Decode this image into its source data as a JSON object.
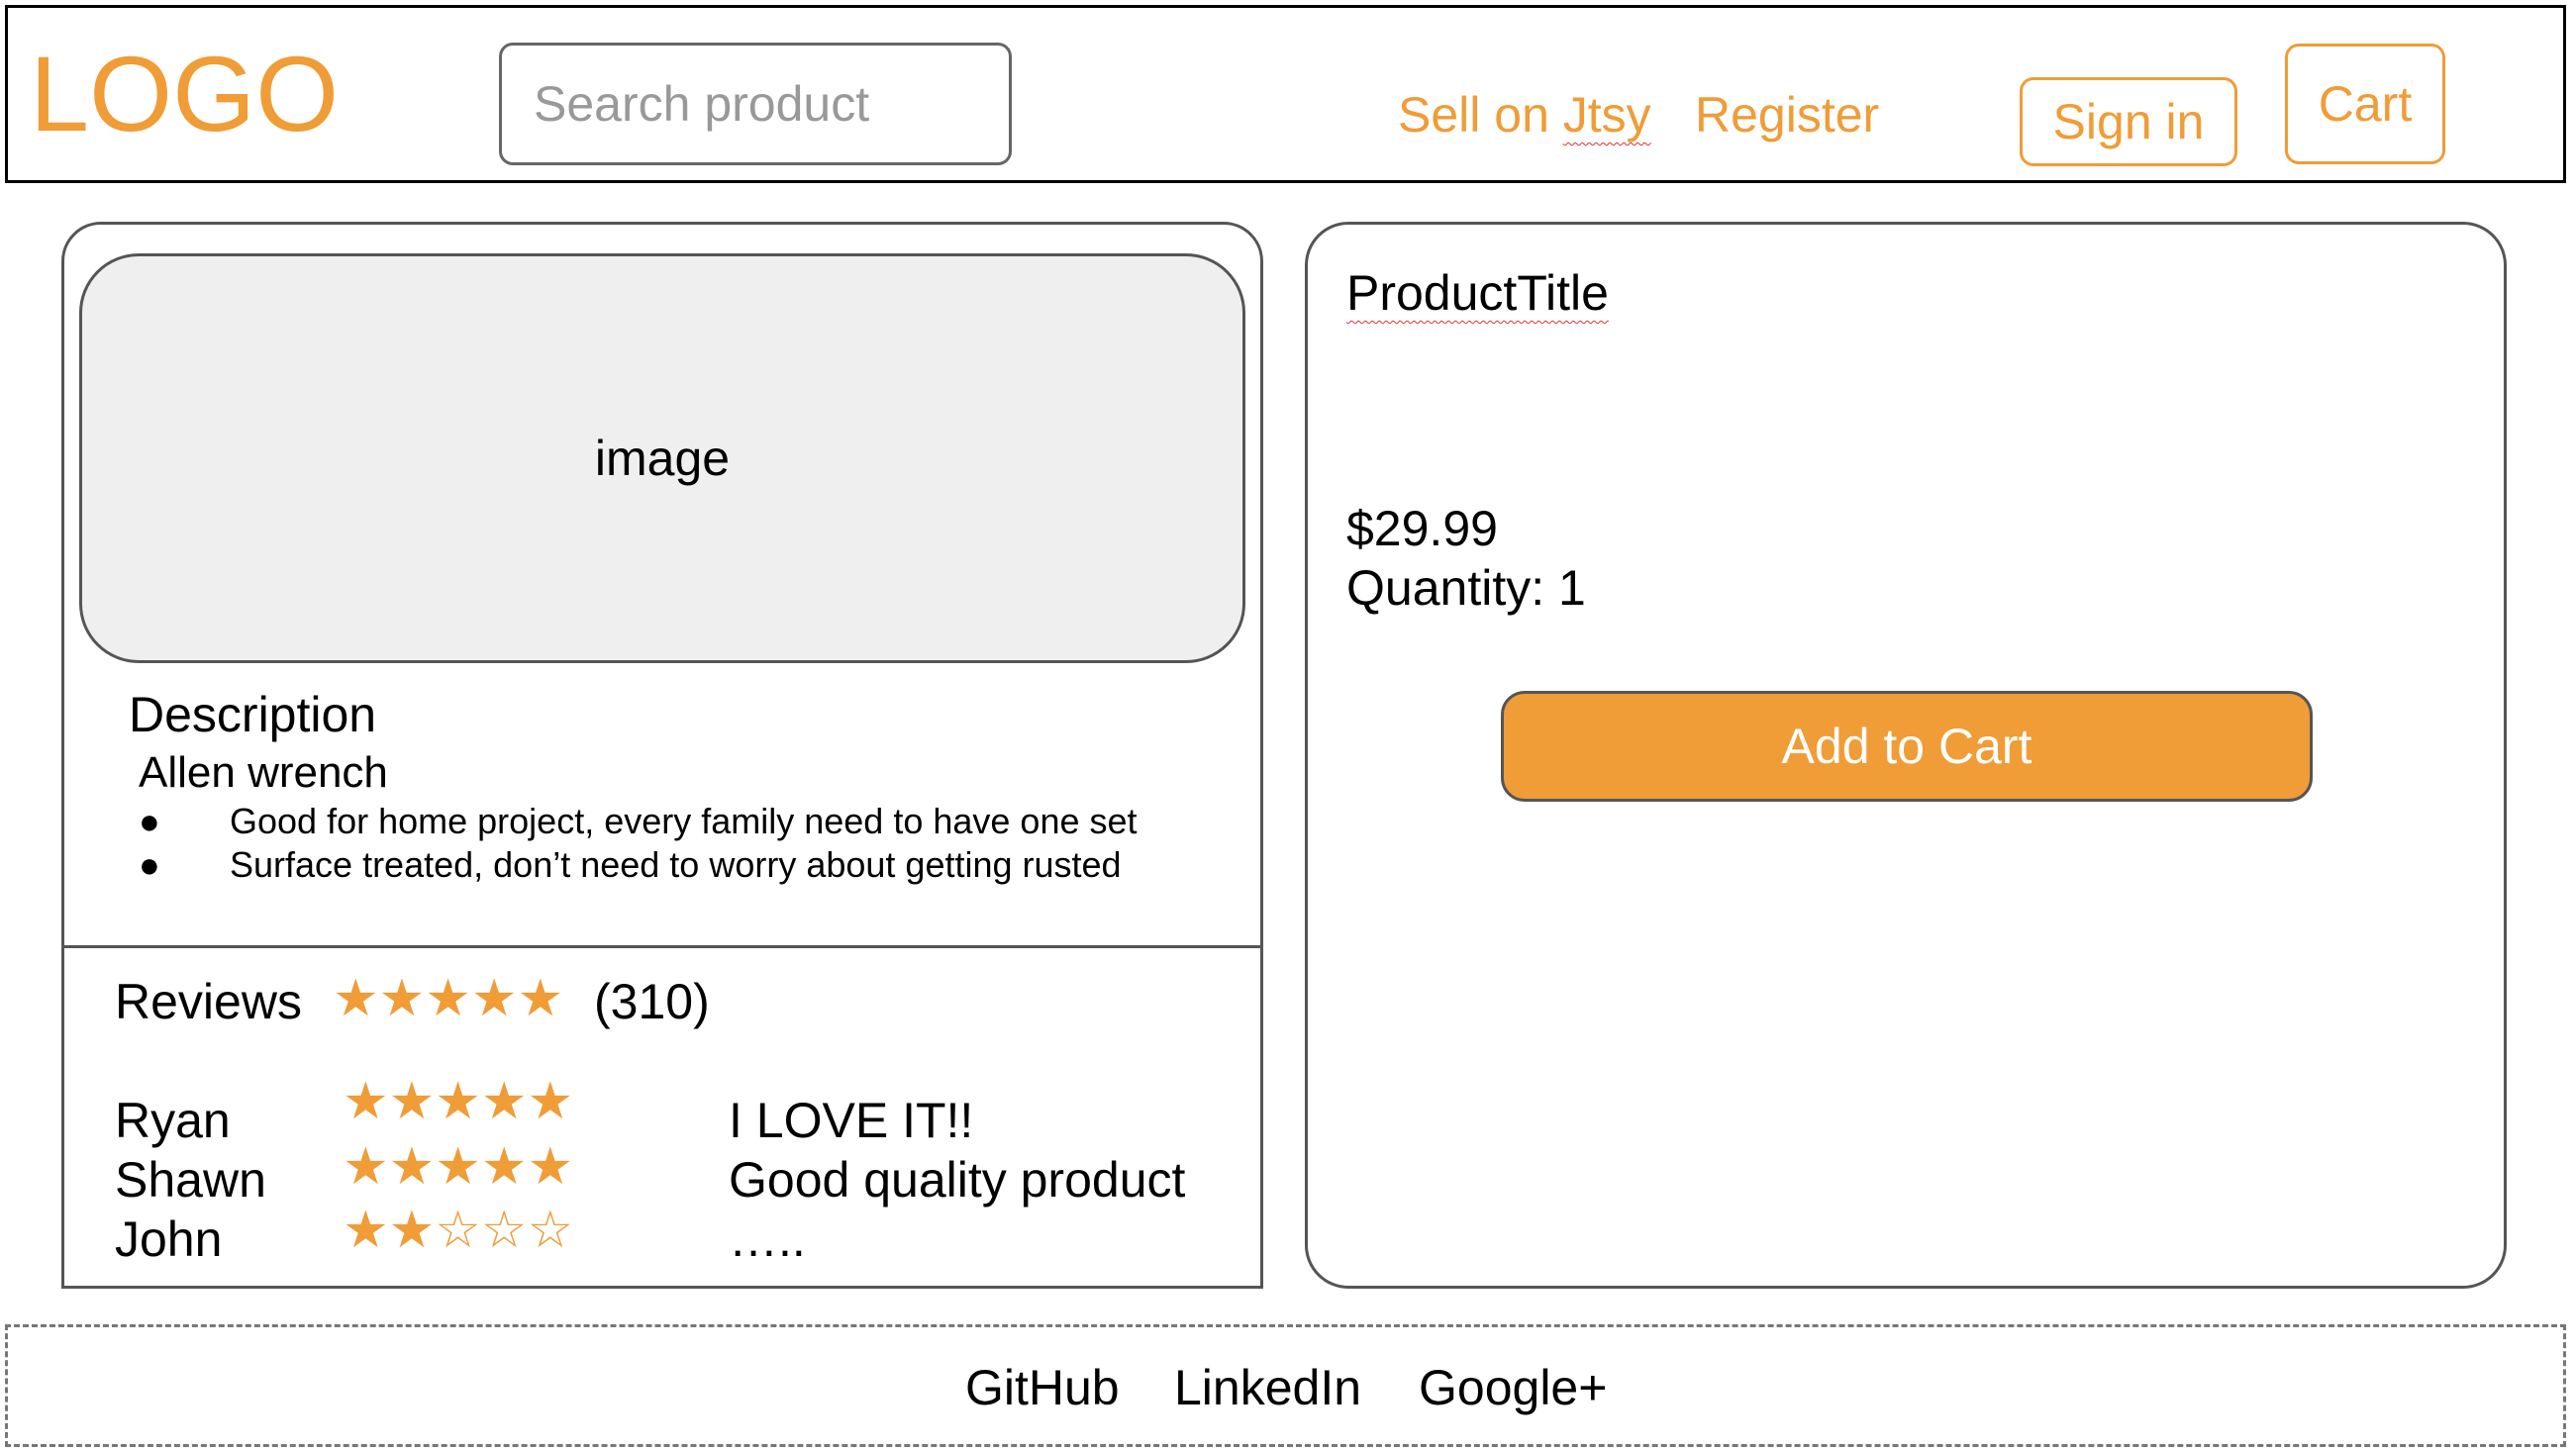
{
  "header": {
    "logo": "LOGO",
    "search_placeholder": "Search product",
    "nav": {
      "sell": "Sell on Jtsy",
      "register": "Register",
      "sign_in": "Sign in",
      "cart": "Cart"
    }
  },
  "product_media": {
    "image_label": "image"
  },
  "description": {
    "title": "Description",
    "product_name": "Allen wrench",
    "bullets": [
      "Good for home project, every family need to have one set",
      "Surface treated, don’t need to worry about getting rusted"
    ]
  },
  "reviews": {
    "title": "Reviews",
    "average_stars": "★★★★★",
    "average_rating": 5,
    "count": "(310)",
    "items": [
      {
        "name": "Ryan",
        "stars": "★★★★★",
        "rating": 5,
        "text": "I LOVE IT!!"
      },
      {
        "name": "Shawn",
        "stars": "★★★★★",
        "rating": 5,
        "text": "Good quality product"
      },
      {
        "name": "John",
        "stars": "★★☆☆☆",
        "rating": 2,
        "text": "….."
      }
    ]
  },
  "product": {
    "title": "ProductTitle",
    "price": "$29.99",
    "quantity": "Quantity: 1",
    "add_to_cart": "Add to Cart"
  },
  "footer": {
    "links": [
      "GitHub",
      "LinkedIn",
      "Google+"
    ]
  },
  "colors": {
    "accent": "#f09c37",
    "image_placeholder_bg": "#efefef"
  }
}
